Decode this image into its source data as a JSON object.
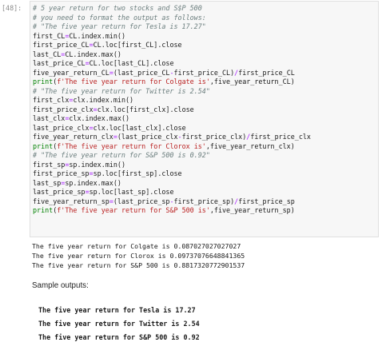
{
  "cell": {
    "prompt": "[48]:",
    "code_lines": [
      [
        {
          "t": "# 5 year return for two stocks and S$P 500",
          "c": "cm"
        }
      ],
      [
        {
          "t": "# you need to format the output as follows:",
          "c": "cm"
        }
      ],
      [
        {
          "t": "# \"The five year return for Tesla is 17.27\"",
          "c": "cm"
        }
      ],
      [
        {
          "t": "first_CL",
          "c": ""
        },
        {
          "t": "=",
          "c": "op"
        },
        {
          "t": "CL.index.min()",
          "c": ""
        }
      ],
      [
        {
          "t": "first_price_CL",
          "c": ""
        },
        {
          "t": "=",
          "c": "op"
        },
        {
          "t": "CL.loc[first_CL].close",
          "c": ""
        }
      ],
      [
        {
          "t": "last_CL",
          "c": ""
        },
        {
          "t": "=",
          "c": "op"
        },
        {
          "t": "CL.index.max()",
          "c": ""
        }
      ],
      [
        {
          "t": "last_price_CL",
          "c": ""
        },
        {
          "t": "=",
          "c": "op"
        },
        {
          "t": "CL.loc[last_CL].close",
          "c": ""
        }
      ],
      [
        {
          "t": "five_year_return_CL",
          "c": ""
        },
        {
          "t": "=",
          "c": "op"
        },
        {
          "t": "(last_price_CL",
          "c": ""
        },
        {
          "t": "-",
          "c": "op"
        },
        {
          "t": "first_price_CL)",
          "c": ""
        },
        {
          "t": "/",
          "c": "op"
        },
        {
          "t": "first_price_CL",
          "c": ""
        }
      ],
      [
        {
          "t": "print",
          "c": "kw"
        },
        {
          "t": "(",
          "c": ""
        },
        {
          "t": "f'The five year return for Colgate is'",
          "c": "st"
        },
        {
          "t": ",five_year_return_CL)",
          "c": ""
        }
      ],
      [
        {
          "t": "# \"The five year return for Twitter is 2.54\"",
          "c": "cm"
        }
      ],
      [
        {
          "t": "first_clx",
          "c": ""
        },
        {
          "t": "=",
          "c": "op"
        },
        {
          "t": "clx.index.min()",
          "c": ""
        }
      ],
      [
        {
          "t": "first_price_clx",
          "c": ""
        },
        {
          "t": "=",
          "c": "op"
        },
        {
          "t": "clx.loc[first_clx].close",
          "c": ""
        }
      ],
      [
        {
          "t": "last_clx",
          "c": ""
        },
        {
          "t": "=",
          "c": "op"
        },
        {
          "t": "clx.index.max()",
          "c": ""
        }
      ],
      [
        {
          "t": "last_price_clx",
          "c": ""
        },
        {
          "t": "=",
          "c": "op"
        },
        {
          "t": "clx.loc[last_clx].close",
          "c": ""
        }
      ],
      [
        {
          "t": "five_year_return_clx",
          "c": ""
        },
        {
          "t": "=",
          "c": "op"
        },
        {
          "t": "(last_price_clx",
          "c": ""
        },
        {
          "t": "-",
          "c": "op"
        },
        {
          "t": "first_price_clx)",
          "c": ""
        },
        {
          "t": "/",
          "c": "op"
        },
        {
          "t": "first_price_clx",
          "c": ""
        }
      ],
      [
        {
          "t": "print",
          "c": "kw"
        },
        {
          "t": "(",
          "c": ""
        },
        {
          "t": "f'The five year return for Clorox is'",
          "c": "st"
        },
        {
          "t": ",five_year_return_clx)",
          "c": ""
        }
      ],
      [
        {
          "t": "# \"The five year return for S&P 500 is 0.92\"",
          "c": "cm"
        }
      ],
      [
        {
          "t": "first_sp",
          "c": ""
        },
        {
          "t": "=",
          "c": "op"
        },
        {
          "t": "sp.index.min()",
          "c": ""
        }
      ],
      [
        {
          "t": "first_price_sp",
          "c": ""
        },
        {
          "t": "=",
          "c": "op"
        },
        {
          "t": "sp.loc[first_sp].close",
          "c": ""
        }
      ],
      [
        {
          "t": "last_sp",
          "c": ""
        },
        {
          "t": "=",
          "c": "op"
        },
        {
          "t": "sp.index.max()",
          "c": ""
        }
      ],
      [
        {
          "t": "last_price_sp",
          "c": ""
        },
        {
          "t": "=",
          "c": "op"
        },
        {
          "t": "sp.loc[last_sp].close",
          "c": ""
        }
      ],
      [
        {
          "t": "five_year_return_sp",
          "c": ""
        },
        {
          "t": "=",
          "c": "op"
        },
        {
          "t": "(last_price_sp",
          "c": ""
        },
        {
          "t": "-",
          "c": "op"
        },
        {
          "t": "first_price_sp)",
          "c": ""
        },
        {
          "t": "/",
          "c": "op"
        },
        {
          "t": "first_price_sp",
          "c": ""
        }
      ],
      [
        {
          "t": "print",
          "c": "kw"
        },
        {
          "t": "(",
          "c": ""
        },
        {
          "t": "f'The five year return for S&P 500 is'",
          "c": "st"
        },
        {
          "t": ",five_year_return_sp)",
          "c": ""
        }
      ]
    ]
  },
  "output": {
    "lines": [
      "The five year return for Colgate is 0.087027027027027",
      "The five year return for Clorox is 0.09737076648841365",
      "The five year return for S&P 500 is 0.8817320772901537"
    ]
  },
  "markdown": {
    "heading": "Sample outputs:",
    "lines": [
      "The five year return for Tesla is 17.27",
      "The five year return for Twitter is 2.54",
      "The five year return for S&P 500 is 0.92"
    ]
  }
}
